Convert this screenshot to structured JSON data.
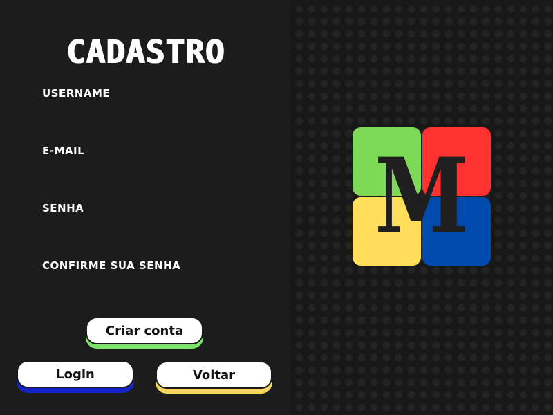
{
  "form": {
    "title": "CADASTRO",
    "fields": [
      {
        "label": "USERNAME",
        "value": "",
        "placeholder": ""
      },
      {
        "label": "E-MAIL",
        "value": "",
        "placeholder": ""
      },
      {
        "label": "SENHA",
        "value": "",
        "placeholder": ""
      },
      {
        "label": "CONFIRME SUA SENHA",
        "value": "",
        "placeholder": ""
      }
    ]
  },
  "buttons": {
    "create_account": "Criar conta",
    "login": "Login",
    "back": "Voltar"
  },
  "logo": {
    "letter": "M",
    "colors": {
      "green": "#7ed957",
      "red": "#ff3131",
      "yellow": "#ffde59",
      "blue": "#004aad"
    }
  },
  "colors": {
    "background": "#1c1c1c",
    "create_accent": "#7ee36a",
    "login_accent": "#1424c8",
    "back_accent": "#f5d75a"
  }
}
